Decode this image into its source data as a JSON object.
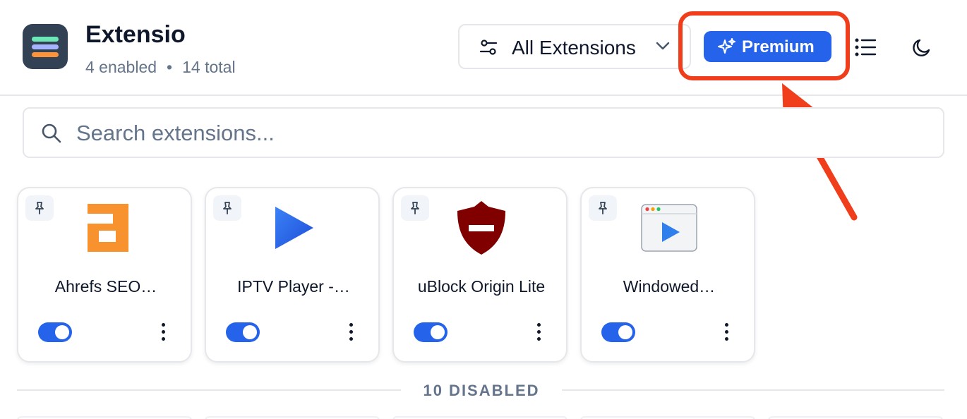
{
  "header": {
    "title": "Extensio",
    "enabled_text": "4 enabled",
    "separator": "•",
    "total_text": "14 total",
    "filter_label": "All Extensions",
    "premium_label": "Premium"
  },
  "search": {
    "placeholder": "Search extensions..."
  },
  "extensions": [
    {
      "name": "Ahrefs SEO…",
      "icon": "ahrefs-logo",
      "enabled": true
    },
    {
      "name": "IPTV Player -…",
      "icon": "play-triangle-logo",
      "enabled": true
    },
    {
      "name": "uBlock Origin Lite",
      "icon": "shield-logo",
      "enabled": true
    },
    {
      "name": "Windowed…",
      "icon": "browser-window-play-logo",
      "enabled": true
    }
  ],
  "disabled_section": {
    "label": "10 DISABLED"
  },
  "colors": {
    "accent": "#2563eb",
    "highlight": "#f03e1c",
    "ahrefs_orange": "#f7922e",
    "ublock_red": "#800000"
  }
}
